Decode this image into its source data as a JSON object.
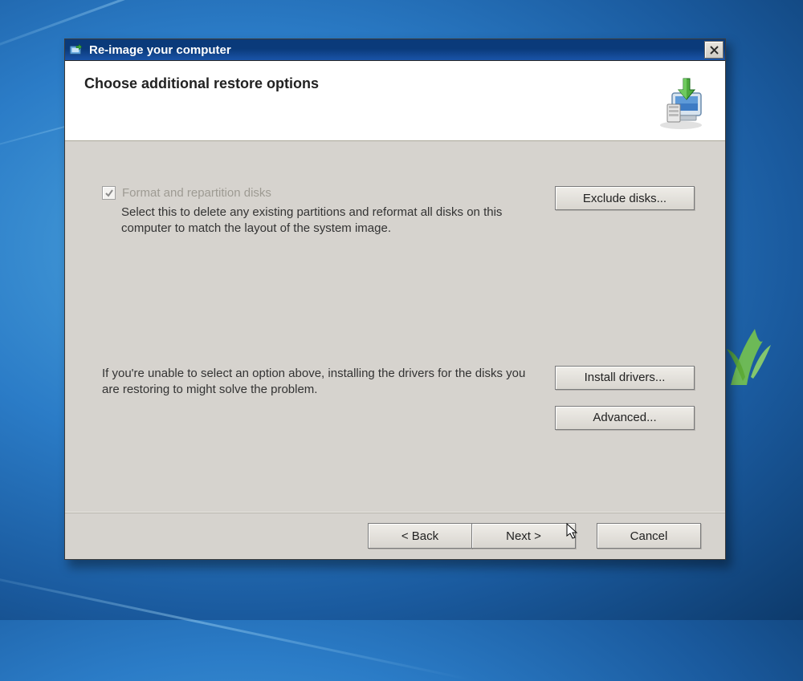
{
  "window": {
    "title": "Re-image your computer",
    "close_symbol": "✕"
  },
  "header": {
    "title": "Choose additional restore options"
  },
  "options": {
    "format": {
      "label": "Format and repartition disks",
      "description": "Select this to delete any existing partitions and reformat all disks on this computer to match the layout of the system image.",
      "checked": true,
      "enabled": false
    },
    "drivers": {
      "description": "If you're unable to select an option above, installing the drivers for the disks you are restoring to might solve the problem."
    }
  },
  "buttons": {
    "exclude": "Exclude disks...",
    "install_drivers": "Install drivers...",
    "advanced": "Advanced...",
    "back": "< Back",
    "next": "Next >",
    "cancel": "Cancel"
  }
}
